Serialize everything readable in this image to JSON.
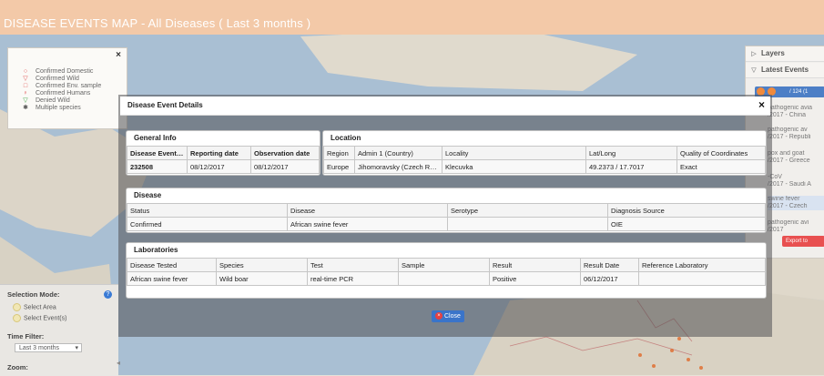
{
  "app": {
    "title": "DISEASE EVENTS MAP - All Diseases ( Last 3 months )"
  },
  "colors": {
    "topbar": "#f3c9a8",
    "accent": "#3a74c9",
    "danger": "#e64040"
  },
  "legend": {
    "close": "×",
    "items": [
      {
        "icon": "circle-icon",
        "symbol": "○",
        "color": "#e05050",
        "label": "Confirmed Domestic"
      },
      {
        "icon": "triangle-down-icon",
        "symbol": "▽",
        "color": "#e05050",
        "label": "Confirmed Wild"
      },
      {
        "icon": "square-icon",
        "symbol": "□",
        "color": "#e05050",
        "label": "Confirmed Env. sample"
      },
      {
        "icon": "human-icon",
        "symbol": "♀",
        "color": "#e05050",
        "label": "Confirmed Humans"
      },
      {
        "icon": "triangle-down-icon",
        "symbol": "▽",
        "color": "#3aa040",
        "label": "Denied Wild"
      },
      {
        "icon": "star-icon",
        "symbol": "✱",
        "color": "#555555",
        "label": "Multiple species"
      }
    ]
  },
  "left_panel": {
    "selection_mode_label": "Selection Mode:",
    "help": "?",
    "option_area": "Select Area",
    "option_events": "Select Event(s)",
    "time_filter_label": "Time Filter:",
    "time_filter_value": "Last 3 months",
    "time_filter_caret": "▾",
    "zoom_label": "Zoom:",
    "collapse_arrow": "◂"
  },
  "right_panel": {
    "layers_label": "Layers",
    "latest_label": "Latest Events",
    "pager_text": "/ 124 (1",
    "items": [
      "pathogenic avia",
      "/2017 - China",
      "pathogenic av",
      "/2017 - Republi",
      "pox and goat",
      "/2017 - Greece",
      "-CoV",
      "/2017 - Saudi A",
      "swine fever",
      "/2017 - Czech",
      "pathogenic avi",
      "/2017"
    ],
    "export_label": "Export to"
  },
  "dialog": {
    "title": "Disease Event Details",
    "close": "×",
    "general_info": {
      "title": "General Info",
      "headers": [
        "Disease Event ID",
        "Reporting date",
        "Observation date"
      ],
      "row": [
        "232508",
        "08/12/2017",
        "08/12/2017"
      ]
    },
    "location": {
      "title": "Location",
      "headers": [
        "Region",
        "Admin 1 (Country)",
        "Locality",
        "Lat/Long",
        "Quality of Coordinates"
      ],
      "row": [
        "Europe",
        "Jihomoravsky (Czech Re...",
        "Klecuvka",
        "49.2373 / 17.7017",
        "Exact"
      ]
    },
    "disease": {
      "title": "Disease",
      "headers": [
        "Status",
        "Disease",
        "Serotype",
        "Diagnosis Source"
      ],
      "row": [
        "Confirmed",
        "African swine fever",
        "",
        "OIE"
      ]
    },
    "laboratories": {
      "title": "Laboratories",
      "headers": [
        "Disease Tested",
        "Species",
        "Test",
        "Sample",
        "Result",
        "Result Date",
        "Reference Laboratory"
      ],
      "row": [
        "African swine fever",
        "Wild boar",
        "real-time PCR",
        "",
        "Positive",
        "06/12/2017",
        ""
      ]
    },
    "close_button": "Close",
    "close_icon": "×"
  }
}
